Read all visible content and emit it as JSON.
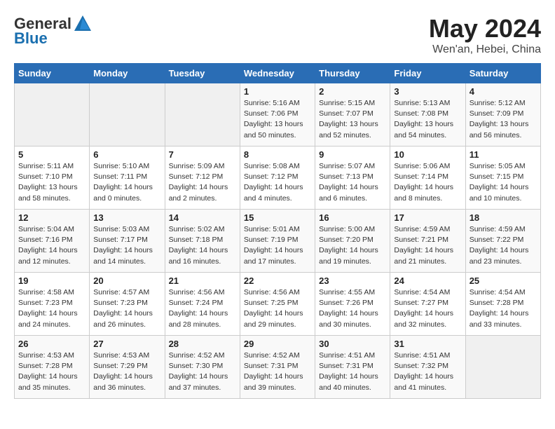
{
  "header": {
    "logo_general": "General",
    "logo_blue": "Blue",
    "month_year": "May 2024",
    "location": "Wen'an, Hebei, China"
  },
  "days_of_week": [
    "Sunday",
    "Monday",
    "Tuesday",
    "Wednesday",
    "Thursday",
    "Friday",
    "Saturday"
  ],
  "weeks": [
    [
      {
        "day": "",
        "info": ""
      },
      {
        "day": "",
        "info": ""
      },
      {
        "day": "",
        "info": ""
      },
      {
        "day": "1",
        "info": "Sunrise: 5:16 AM\nSunset: 7:06 PM\nDaylight: 13 hours\nand 50 minutes."
      },
      {
        "day": "2",
        "info": "Sunrise: 5:15 AM\nSunset: 7:07 PM\nDaylight: 13 hours\nand 52 minutes."
      },
      {
        "day": "3",
        "info": "Sunrise: 5:13 AM\nSunset: 7:08 PM\nDaylight: 13 hours\nand 54 minutes."
      },
      {
        "day": "4",
        "info": "Sunrise: 5:12 AM\nSunset: 7:09 PM\nDaylight: 13 hours\nand 56 minutes."
      }
    ],
    [
      {
        "day": "5",
        "info": "Sunrise: 5:11 AM\nSunset: 7:10 PM\nDaylight: 13 hours\nand 58 minutes."
      },
      {
        "day": "6",
        "info": "Sunrise: 5:10 AM\nSunset: 7:11 PM\nDaylight: 14 hours\nand 0 minutes."
      },
      {
        "day": "7",
        "info": "Sunrise: 5:09 AM\nSunset: 7:12 PM\nDaylight: 14 hours\nand 2 minutes."
      },
      {
        "day": "8",
        "info": "Sunrise: 5:08 AM\nSunset: 7:12 PM\nDaylight: 14 hours\nand 4 minutes."
      },
      {
        "day": "9",
        "info": "Sunrise: 5:07 AM\nSunset: 7:13 PM\nDaylight: 14 hours\nand 6 minutes."
      },
      {
        "day": "10",
        "info": "Sunrise: 5:06 AM\nSunset: 7:14 PM\nDaylight: 14 hours\nand 8 minutes."
      },
      {
        "day": "11",
        "info": "Sunrise: 5:05 AM\nSunset: 7:15 PM\nDaylight: 14 hours\nand 10 minutes."
      }
    ],
    [
      {
        "day": "12",
        "info": "Sunrise: 5:04 AM\nSunset: 7:16 PM\nDaylight: 14 hours\nand 12 minutes."
      },
      {
        "day": "13",
        "info": "Sunrise: 5:03 AM\nSunset: 7:17 PM\nDaylight: 14 hours\nand 14 minutes."
      },
      {
        "day": "14",
        "info": "Sunrise: 5:02 AM\nSunset: 7:18 PM\nDaylight: 14 hours\nand 16 minutes."
      },
      {
        "day": "15",
        "info": "Sunrise: 5:01 AM\nSunset: 7:19 PM\nDaylight: 14 hours\nand 17 minutes."
      },
      {
        "day": "16",
        "info": "Sunrise: 5:00 AM\nSunset: 7:20 PM\nDaylight: 14 hours\nand 19 minutes."
      },
      {
        "day": "17",
        "info": "Sunrise: 4:59 AM\nSunset: 7:21 PM\nDaylight: 14 hours\nand 21 minutes."
      },
      {
        "day": "18",
        "info": "Sunrise: 4:59 AM\nSunset: 7:22 PM\nDaylight: 14 hours\nand 23 minutes."
      }
    ],
    [
      {
        "day": "19",
        "info": "Sunrise: 4:58 AM\nSunset: 7:23 PM\nDaylight: 14 hours\nand 24 minutes."
      },
      {
        "day": "20",
        "info": "Sunrise: 4:57 AM\nSunset: 7:23 PM\nDaylight: 14 hours\nand 26 minutes."
      },
      {
        "day": "21",
        "info": "Sunrise: 4:56 AM\nSunset: 7:24 PM\nDaylight: 14 hours\nand 28 minutes."
      },
      {
        "day": "22",
        "info": "Sunrise: 4:56 AM\nSunset: 7:25 PM\nDaylight: 14 hours\nand 29 minutes."
      },
      {
        "day": "23",
        "info": "Sunrise: 4:55 AM\nSunset: 7:26 PM\nDaylight: 14 hours\nand 30 minutes."
      },
      {
        "day": "24",
        "info": "Sunrise: 4:54 AM\nSunset: 7:27 PM\nDaylight: 14 hours\nand 32 minutes."
      },
      {
        "day": "25",
        "info": "Sunrise: 4:54 AM\nSunset: 7:28 PM\nDaylight: 14 hours\nand 33 minutes."
      }
    ],
    [
      {
        "day": "26",
        "info": "Sunrise: 4:53 AM\nSunset: 7:28 PM\nDaylight: 14 hours\nand 35 minutes."
      },
      {
        "day": "27",
        "info": "Sunrise: 4:53 AM\nSunset: 7:29 PM\nDaylight: 14 hours\nand 36 minutes."
      },
      {
        "day": "28",
        "info": "Sunrise: 4:52 AM\nSunset: 7:30 PM\nDaylight: 14 hours\nand 37 minutes."
      },
      {
        "day": "29",
        "info": "Sunrise: 4:52 AM\nSunset: 7:31 PM\nDaylight: 14 hours\nand 39 minutes."
      },
      {
        "day": "30",
        "info": "Sunrise: 4:51 AM\nSunset: 7:31 PM\nDaylight: 14 hours\nand 40 minutes."
      },
      {
        "day": "31",
        "info": "Sunrise: 4:51 AM\nSunset: 7:32 PM\nDaylight: 14 hours\nand 41 minutes."
      },
      {
        "day": "",
        "info": ""
      }
    ]
  ]
}
